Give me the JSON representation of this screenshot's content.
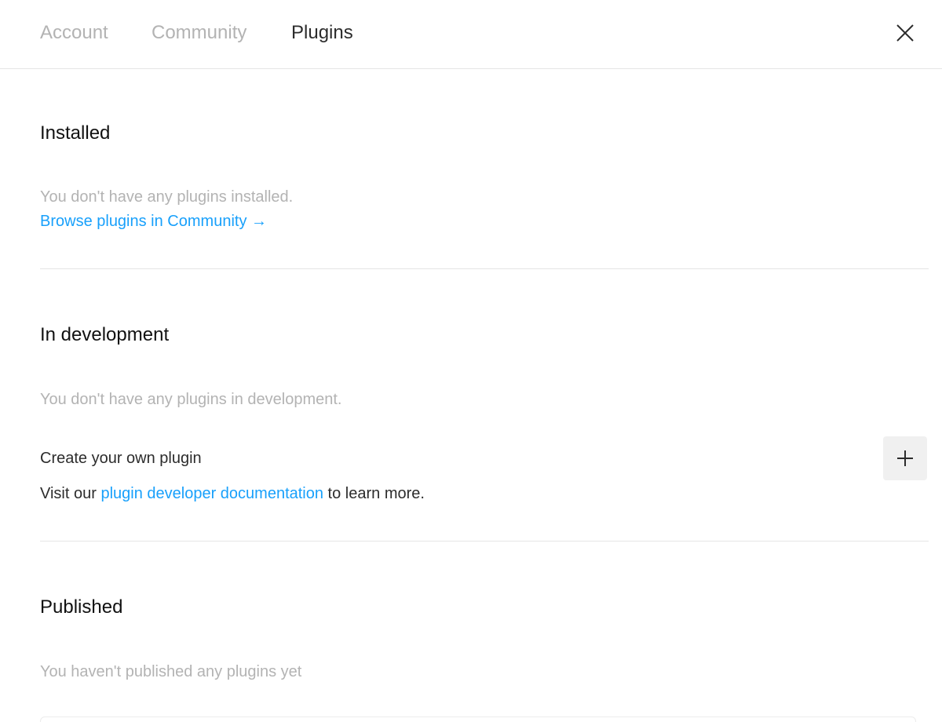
{
  "tabs": [
    {
      "label": "Account",
      "active": false
    },
    {
      "label": "Community",
      "active": false
    },
    {
      "label": "Plugins",
      "active": true
    }
  ],
  "close_icon": "close-icon",
  "installed": {
    "title": "Installed",
    "empty_text": "You don't have any plugins installed.",
    "browse_link": "Browse plugins in Community →"
  },
  "development": {
    "title": "In development",
    "empty_text": "You don't have any plugins in development.",
    "create_label": "Create your own plugin",
    "visit_prefix": "Visit our ",
    "docs_link": "plugin developer documentation",
    "visit_suffix": " to learn more.",
    "add_icon": "plus-icon"
  },
  "published": {
    "title": "Published",
    "empty_text": "You haven't published any plugins yet"
  },
  "colors": {
    "link": "#18a0fb",
    "muted": "#b3b3b3",
    "divider": "#e5e5e5",
    "button_bg": "#f0f0f0"
  }
}
